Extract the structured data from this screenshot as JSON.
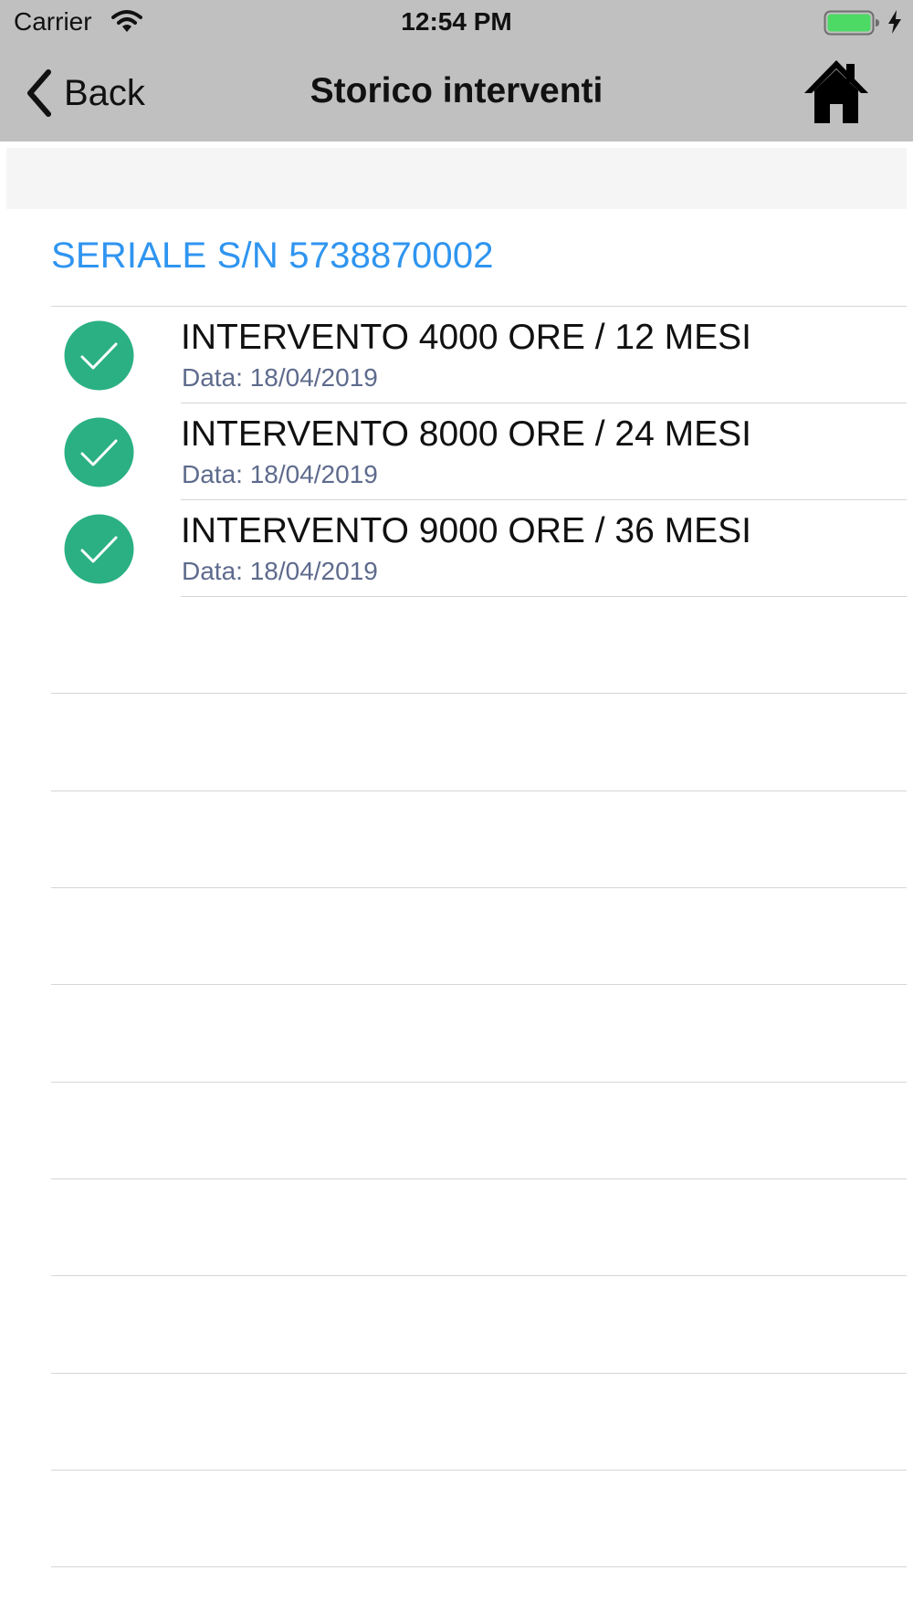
{
  "status_bar": {
    "carrier": "Carrier",
    "time": "12:54 PM",
    "icons": [
      "wifi-icon",
      "battery-icon",
      "charging-icon"
    ],
    "battery_color": "#4cd964"
  },
  "nav": {
    "back_label": "Back",
    "title": "Storico interventi",
    "icons": [
      "chevron-left-icon",
      "home-icon"
    ]
  },
  "section": {
    "header": "SERIALE S/N 5738870002"
  },
  "items": [
    {
      "title": "INTERVENTO 4000 ORE / 12 MESI",
      "date": "Data: 18/04/2019",
      "icon": "check-circle-icon"
    },
    {
      "title": "INTERVENTO 8000 ORE / 24 MESI",
      "date": "Data: 18/04/2019",
      "icon": "check-circle-icon"
    },
    {
      "title": "INTERVENTO 9000 ORE / 36 MESI",
      "date": "Data: 18/04/2019",
      "icon": "check-circle-icon"
    }
  ],
  "colors": {
    "nav_background": "#c0c0c0",
    "accent": "#2f95f0",
    "check": "#2bb083",
    "date_text": "#5e6b8d"
  }
}
